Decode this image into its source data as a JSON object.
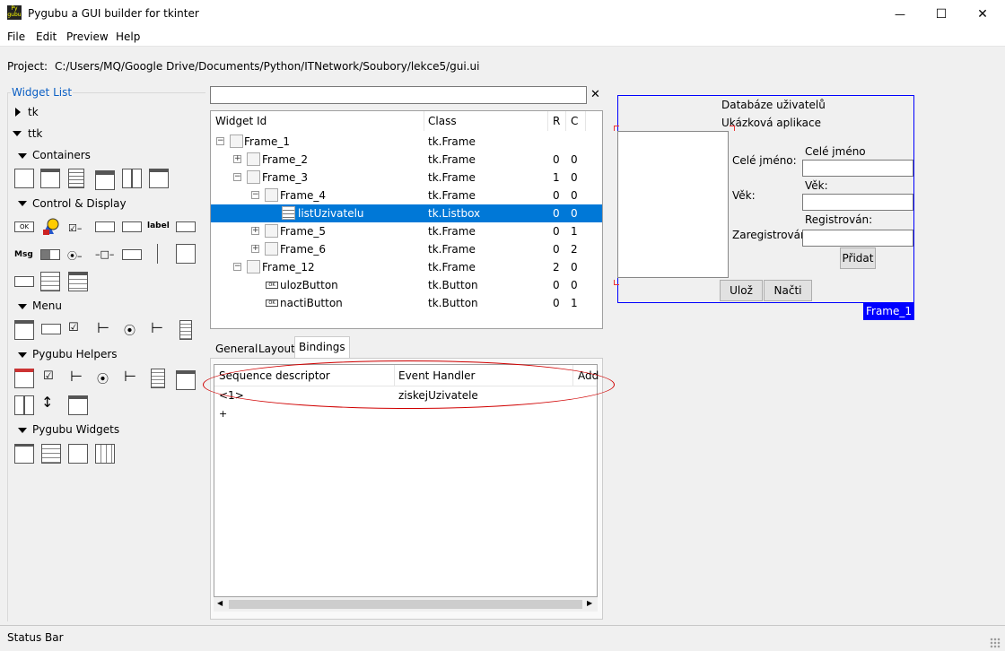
{
  "window": {
    "title": "Pygubu a GUI builder for tkinter",
    "icon_text": "Py gubu",
    "controls": {
      "minimize": "—",
      "maximize": "☐",
      "close": "✕"
    }
  },
  "menu": [
    "File",
    "Edit",
    "Preview",
    "Help"
  ],
  "project": {
    "label": "Project:",
    "path": "C:/Users/MQ/Google Drive/Documents/Python/ITNetwork/Soubory/lekce5/gui.ui"
  },
  "widget_list": {
    "title": "Widget List",
    "sections": [
      {
        "label": "tk",
        "expanded": false
      },
      {
        "label": "ttk",
        "expanded": true
      },
      {
        "label": "Containers",
        "expanded": true
      },
      {
        "label": "Control & Display",
        "expanded": true
      },
      {
        "label": "Menu",
        "expanded": true
      },
      {
        "label": "Pygubu Helpers",
        "expanded": true
      },
      {
        "label": "Pygubu Widgets",
        "expanded": true
      }
    ],
    "icon_labels": {
      "ok": "OK",
      "label": "label",
      "msg": "Msg"
    }
  },
  "search": {
    "value": "",
    "clear": "✕"
  },
  "tree": {
    "columns": [
      "Widget Id",
      "Class",
      "R",
      "C"
    ],
    "rows": [
      {
        "id": "Frame_1",
        "class": "tk.Frame",
        "r": "",
        "c": "",
        "expander": "−",
        "selected": false
      },
      {
        "id": "Frame_2",
        "class": "tk.Frame",
        "r": "0",
        "c": "0",
        "expander": "+",
        "selected": false
      },
      {
        "id": "Frame_3",
        "class": "tk.Frame",
        "r": "1",
        "c": "0",
        "expander": "−",
        "selected": false
      },
      {
        "id": "Frame_4",
        "class": "tk.Frame",
        "r": "0",
        "c": "0",
        "expander": "−",
        "selected": false
      },
      {
        "id": "listUzivatelu",
        "class": "tk.Listbox",
        "r": "0",
        "c": "0",
        "expander": "",
        "selected": true
      },
      {
        "id": "Frame_5",
        "class": "tk.Frame",
        "r": "0",
        "c": "1",
        "expander": "+",
        "selected": false
      },
      {
        "id": "Frame_6",
        "class": "tk.Frame",
        "r": "0",
        "c": "2",
        "expander": "+",
        "selected": false
      },
      {
        "id": "Frame_12",
        "class": "tk.Frame",
        "r": "2",
        "c": "0",
        "expander": "−",
        "selected": false
      },
      {
        "id": "ulozButton",
        "class": "tk.Button",
        "r": "0",
        "c": "0",
        "expander": "",
        "selected": false
      },
      {
        "id": "nactiButton",
        "class": "tk.Button",
        "r": "0",
        "c": "1",
        "expander": "",
        "selected": false
      }
    ]
  },
  "tabs": [
    "General",
    "Layout",
    "Bindings"
  ],
  "active_tab": "Bindings",
  "bindings": {
    "columns": [
      "Sequence descriptor",
      "Event Handler",
      "Add"
    ],
    "rows": [
      {
        "sequence": "<1>",
        "handler": "ziskejUzivatele",
        "add": ""
      }
    ],
    "add_row": "+"
  },
  "preview": {
    "title": "Databáze uživatelů",
    "subtitle": "Ukázková aplikace",
    "fields": [
      {
        "label": "Celé jméno:",
        "caption": "Celé jméno",
        "value": ""
      },
      {
        "label": "Věk:",
        "caption": "Věk:",
        "value": ""
      },
      {
        "label": "Zaregistrován:",
        "caption": "Registrován:",
        "value": ""
      }
    ],
    "add_button": "Přidat",
    "save_button": "Ulož",
    "load_button": "Načti",
    "frame_tag": "Frame_1"
  },
  "status": "Status Bar",
  "colors": {
    "accent": "#0078d7",
    "preview_border": "#0000ff",
    "annotation": "#d00000"
  }
}
